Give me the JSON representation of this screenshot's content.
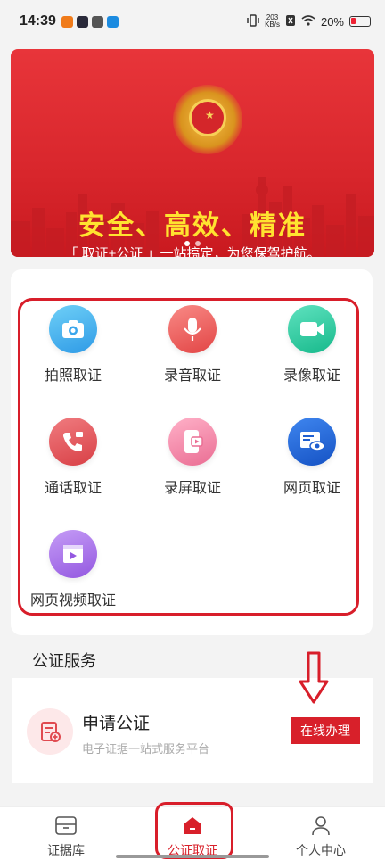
{
  "statusbar": {
    "time": "14:39",
    "speed_top": "203",
    "speed_bottom": "KB/s",
    "battery": "20%"
  },
  "banner": {
    "title": "安全、高效、精准",
    "subtitle": "「 取证+公证 」一站搞定，为您保驾护航。",
    "dots": 2,
    "active_dot": 1
  },
  "features": [
    {
      "label": "拍照取证",
      "icon": "camera-icon",
      "color": "#3fb0ea"
    },
    {
      "label": "录音取证",
      "icon": "microphone-icon",
      "color": "#ee5a5a"
    },
    {
      "label": "录像取证",
      "icon": "video-icon",
      "color": "#2ed0a4"
    },
    {
      "label": "通话取证",
      "icon": "phone-icon",
      "color": "#e4545a"
    },
    {
      "label": "录屏取证",
      "icon": "screen-record-icon",
      "color": "#f285a6"
    },
    {
      "label": "网页取证",
      "icon": "webpage-icon",
      "color": "#2166d8"
    },
    {
      "label": "网页视频取证",
      "icon": "web-video-icon",
      "color": "#a86ee6"
    }
  ],
  "services": {
    "title": "公证服务",
    "item": {
      "name": "申请公证",
      "desc": "电子证据一站式服务平台",
      "button": "在线办理"
    }
  },
  "tabbar": [
    {
      "label": "证据库",
      "icon": "archive-icon"
    },
    {
      "label": "公证取证",
      "icon": "home-icon",
      "active": true
    },
    {
      "label": "个人中心",
      "icon": "user-icon"
    }
  ],
  "colors": {
    "primary": "#d8202a",
    "banner": "#e8353a",
    "banner_title": "#ffe330"
  }
}
